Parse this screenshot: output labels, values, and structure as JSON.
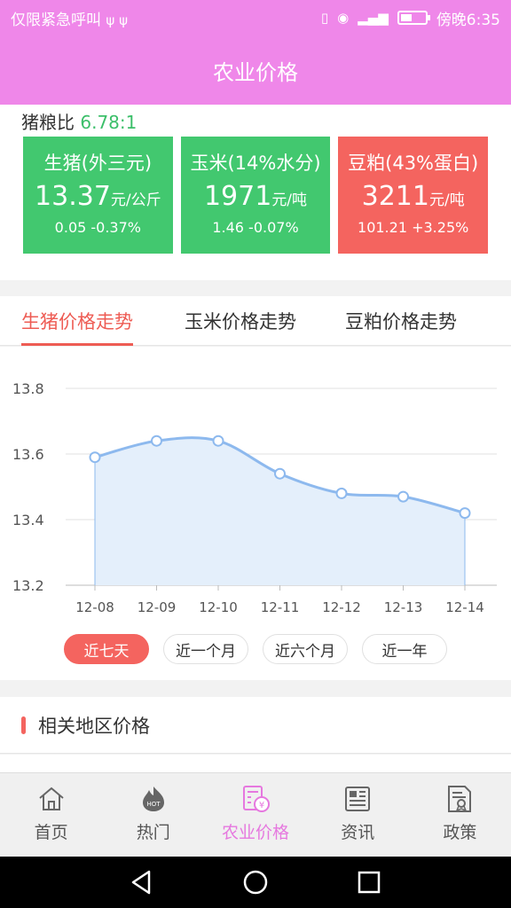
{
  "status_bar": {
    "left_text": "仅限紧急呼叫",
    "time": "傍晚6:35"
  },
  "header": {
    "title": "农业价格"
  },
  "ratio": {
    "label": "猪粮比",
    "value": "6.78:1"
  },
  "cards": [
    {
      "name": "生猪(外三元)",
      "price": "13.37",
      "unit": "元/公斤",
      "change": "0.05  -0.37%",
      "color": "#42c86f"
    },
    {
      "name": "玉米(14%水分)",
      "price": "1971",
      "unit": "元/吨",
      "change": "1.46  -0.07%",
      "color": "#42c86f"
    },
    {
      "name": "豆粕(43%蛋白)",
      "price": "3211",
      "unit": "元/吨",
      "change": "101.21  +3.25%",
      "color": "#f4645f"
    }
  ],
  "tabs": [
    "生猪价格走势",
    "玉米价格走势",
    "豆粕价格走势"
  ],
  "active_tab": 0,
  "chart_data": {
    "type": "area",
    "categories": [
      "12-08",
      "12-09",
      "12-10",
      "12-11",
      "12-12",
      "12-13",
      "12-14"
    ],
    "values": [
      13.59,
      13.64,
      13.64,
      13.54,
      13.48,
      13.47,
      13.42
    ],
    "ylim": [
      13.2,
      13.8
    ],
    "yticks": [
      "13.2",
      "13.4",
      "13.6",
      "13.8"
    ],
    "grid": true,
    "line_color": "#8db9ee",
    "fill_color": "#e4effb"
  },
  "ranges": [
    "近七天",
    "近一个月",
    "近六个月",
    "近一年"
  ],
  "active_range": 0,
  "related": {
    "title": "相关地区价格"
  },
  "bottom_nav": [
    {
      "label": "首页",
      "icon": "home-icon"
    },
    {
      "label": "热门",
      "icon": "hot-icon"
    },
    {
      "label": "农业价格",
      "icon": "price-calculator-icon"
    },
    {
      "label": "资讯",
      "icon": "news-icon"
    },
    {
      "label": "政策",
      "icon": "policy-icon"
    }
  ],
  "active_nav": 2,
  "colors": {
    "header": "#ef87e9",
    "accent_red": "#f4645f",
    "accent_green": "#42c86f",
    "nav_active": "#e678df"
  }
}
